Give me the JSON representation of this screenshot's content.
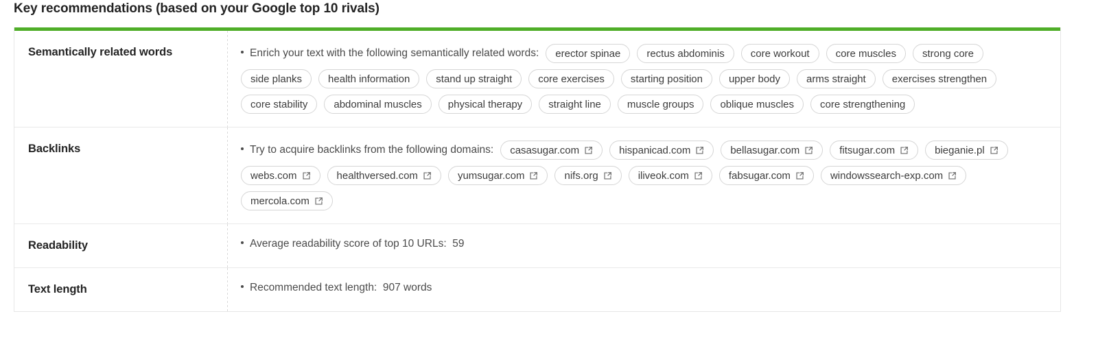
{
  "page": {
    "title": "Key recommendations (based on your Google top 10 rivals)",
    "accent_color": "#4fae28",
    "border_color": "#e6e6e6",
    "text_color": "#4a4a4a",
    "label_color": "#232323"
  },
  "rows": [
    {
      "label": "Semantically related words",
      "lead": "Enrich your text with the following semantically related words:",
      "pill_type": "word",
      "pills": [
        "erector spinae",
        "rectus abdominis",
        "core workout",
        "core muscles",
        "strong core",
        "side planks",
        "health information",
        "stand up straight",
        "core exercises",
        "starting position",
        "upper body",
        "arms straight",
        "exercises strengthen",
        "core stability",
        "abdominal muscles",
        "physical therapy",
        "straight line",
        "muscle groups",
        "oblique muscles",
        "core strengthening"
      ]
    },
    {
      "label": "Backlinks",
      "lead": "Try to acquire backlinks from the following domains:",
      "pill_type": "link",
      "pill_icon": "external-link-icon",
      "pills": [
        "casasugar.com",
        "hispanicad.com",
        "bellasugar.com",
        "fitsugar.com",
        "bieganie.pl",
        "webs.com",
        "healthversed.com",
        "yumsugar.com",
        "nifs.org",
        "iliveok.com",
        "fabsugar.com",
        "windowssearch-exp.com",
        "mercola.com"
      ]
    },
    {
      "label": "Readability",
      "lead": "Average readability score of top 10 URLs:  59",
      "pill_type": "none",
      "pills": []
    },
    {
      "label": "Text length",
      "lead": "Recommended text length:  907 words",
      "pill_type": "none",
      "pills": []
    }
  ]
}
